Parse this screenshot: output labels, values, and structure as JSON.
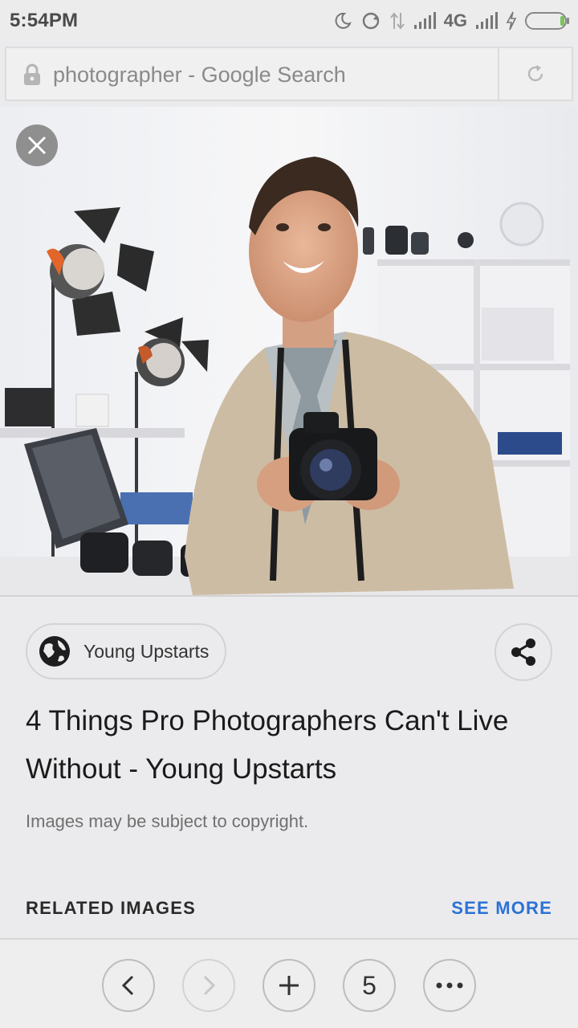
{
  "status_bar": {
    "time": "5:54PM",
    "network": "4G",
    "icons": [
      "moon-icon",
      "sync-icon",
      "data-arrows-icon",
      "signal-icon",
      "signal-icon",
      "charging-icon",
      "battery-icon"
    ]
  },
  "address_bar": {
    "url_text": "photographer - Google Search",
    "icons": [
      "lock-icon",
      "reload-icon"
    ]
  },
  "image_viewer": {
    "close_icon": "close-icon"
  },
  "result": {
    "source_name": "Young Upstarts",
    "source_icon": "globe-icon",
    "share_icon": "share-icon",
    "title": "4 Things Pro Photographers Can't Live Without - Young Upstarts",
    "copyright_note": "Images may be subject to copyright."
  },
  "related": {
    "label": "RELATED IMAGES",
    "see_more": "SEE MORE"
  },
  "bottom_nav": {
    "tab_count": "5",
    "icons": [
      "back-icon",
      "forward-icon",
      "new-tab-icon",
      "tabs-icon",
      "more-icon"
    ]
  },
  "colors": {
    "accent": "#2c72d6",
    "background": "#ebebed"
  }
}
